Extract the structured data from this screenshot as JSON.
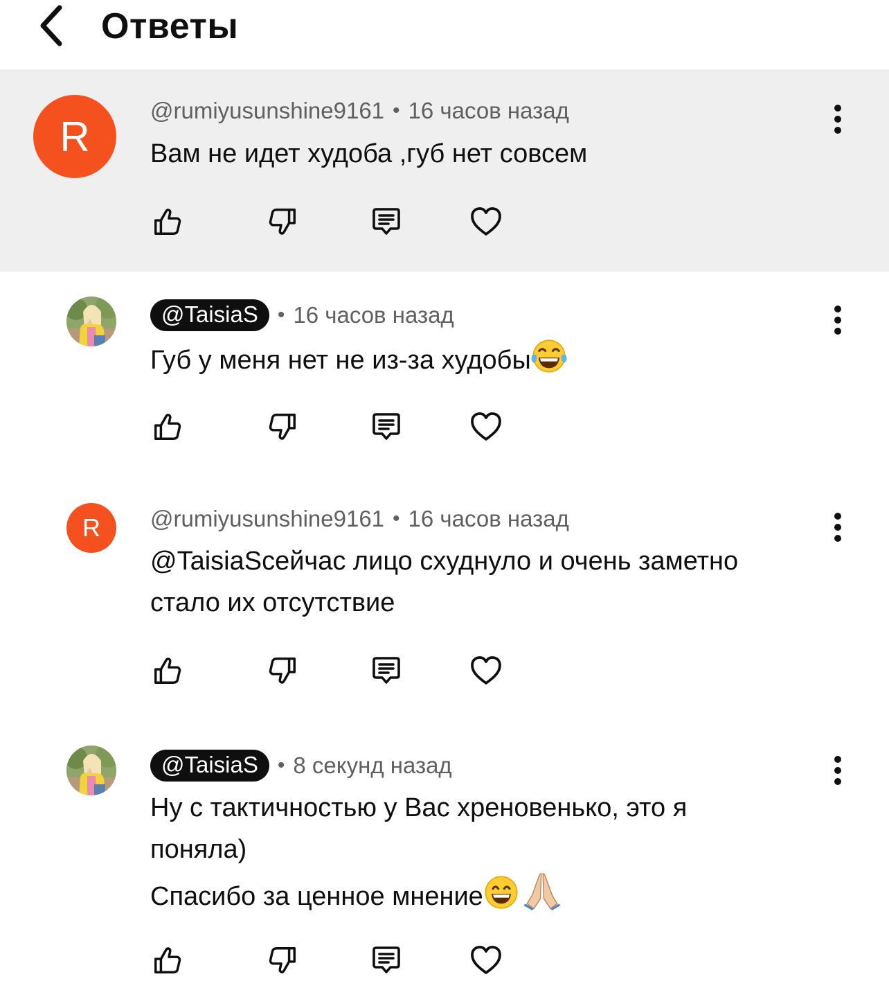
{
  "header": {
    "title": "Ответы"
  },
  "comments": [
    {
      "author": "@rumiyusunshine9161",
      "avatar_letter": "R",
      "time": "16 часов назад",
      "separator": "•",
      "lines": [
        "Вам не идет худоба ,губ нет совсем"
      ],
      "highlighted": true
    },
    {
      "author": "@TaisiaS",
      "time": "16 часов назад",
      "separator": "•",
      "lines": [
        "Губ у меня нет не из-за худобы"
      ],
      "emoji": [
        "face-with-tears-of-joy"
      ]
    },
    {
      "author": "@rumiyusunshine9161",
      "avatar_letter": "R",
      "time": "16 часов назад",
      "separator": "•",
      "lines": [
        "@TaisiaScейчас лицо схуднуло и очень заметно",
        "стало их отсутствие"
      ]
    },
    {
      "author": "@TaisiaS",
      "time": "8 секунд назад",
      "separator": "•",
      "lines": [
        "Ну с тактичностью у Вас хреновенько, это я",
        "поняла)",
        "Спасибо за ценное мнение"
      ],
      "emoji": [
        "grinning-face-with-smiling-eyes",
        "folded-hands"
      ]
    }
  ],
  "actions": [
    "thumbs-up-icon",
    "thumbs-down-icon",
    "reply-icon",
    "heart-icon"
  ],
  "colors": {
    "avatar_orange": "#f4511e",
    "highlight_bg": "#efefef",
    "secondary_text": "#606060",
    "primary_text": "#0f0f0f"
  }
}
